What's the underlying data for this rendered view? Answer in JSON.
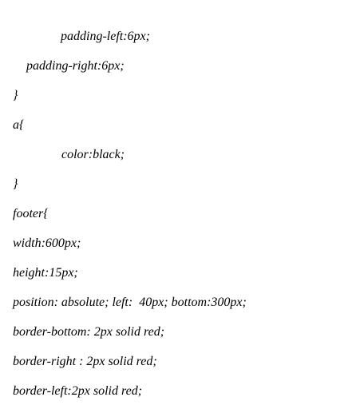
{
  "document": {
    "lines": [
      "padding-left:6px;",
      "padding-right:6px;",
      "}",
      "a{",
      "color:black;",
      "}",
      "footer{",
      "width:600px;",
      "height:15px;",
      "position: absolute; left:  40px; bottom:300px;",
      "border-bottom: 2px solid red;",
      "border-right : 2px solid red;",
      "border-left:2px solid red;"
    ]
  }
}
